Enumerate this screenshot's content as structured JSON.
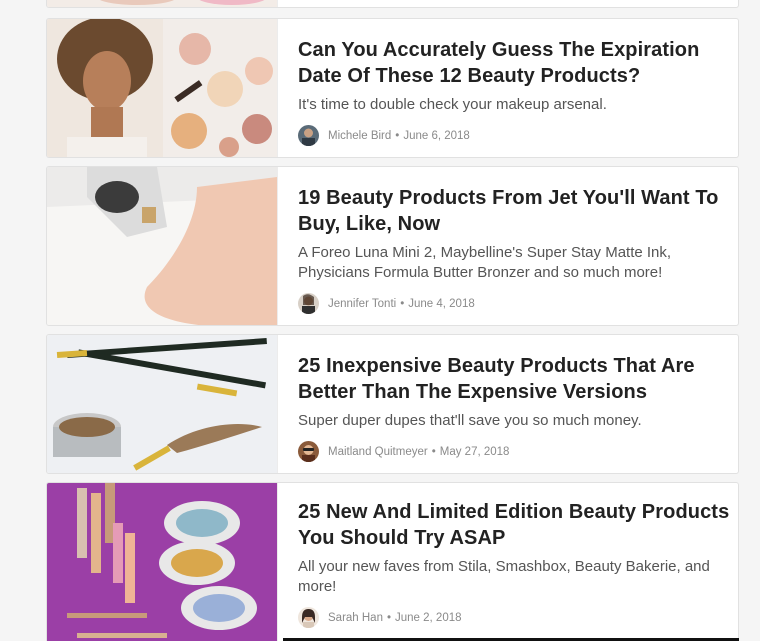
{
  "articles": [
    {
      "title": "Can You Accurately Guess The Expiration Date Of These 12 Beauty Products?",
      "description": "It's time to double check your makeup arsenal.",
      "author": "Michele Bird",
      "separator": "•",
      "date": "June 6, 2018"
    },
    {
      "title": "19 Beauty Products From Jet You'll Want To Buy, Like, Now",
      "description": "A Foreo Luna Mini 2, Maybelline's Super Stay Matte Ink, Physicians Formula Butter Bronzer and so much more!",
      "author": "Jennifer Tonti",
      "separator": "•",
      "date": "June 4, 2018"
    },
    {
      "title": "25 Inexpensive Beauty Products That Are Better Than The Expensive Versions",
      "description": "Super duper dupes that'll save you so much money.",
      "author": "Maitland Quitmeyer",
      "separator": "•",
      "date": "May 27, 2018"
    },
    {
      "title": "25 New And Limited Edition Beauty Products You Should Try ASAP",
      "description": "All your new faves from Stila, Smashbox, Beauty Bakerie, and more!",
      "author": "Sarah Han",
      "separator": "•",
      "date": "June 2, 2018"
    }
  ],
  "colors": {
    "background": "#f5f5f5",
    "card": "#ffffff",
    "title": "#222222",
    "meta": "#8a8a8a"
  }
}
